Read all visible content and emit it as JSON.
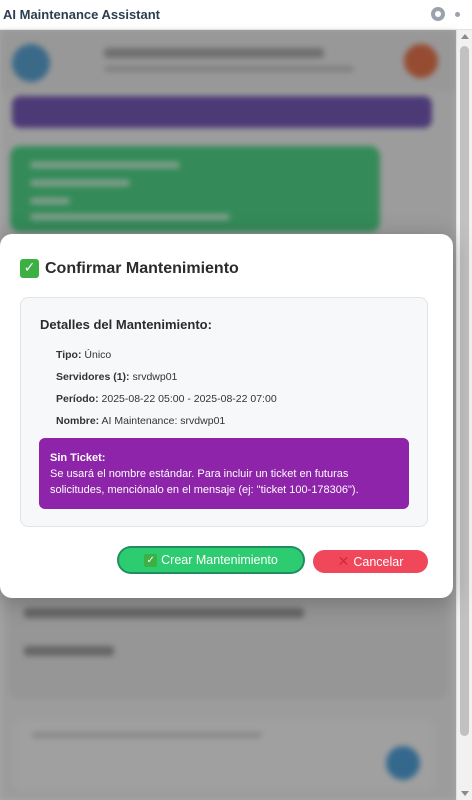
{
  "window": {
    "title": "AI Maintenance Assistant"
  },
  "modal": {
    "title": "Confirmar Mantenimiento",
    "details_title": "Detalles del Mantenimiento:",
    "rows": [
      {
        "label": "Tipo:",
        "value": "Único"
      },
      {
        "label": "Servidores (1):",
        "value": "srvdwp01"
      },
      {
        "label": "Período:",
        "value": "2025-08-22 05:00 - 2025-08-22 07:00"
      },
      {
        "label": "Nombre:",
        "value": "AI Maintenance: srvdwp01"
      }
    ],
    "notice_title": "Sin Ticket:",
    "notice_text": "Se usará el nombre estándar. Para incluir un ticket en futuras solicitudes, menciónalo en el mensaje (ej: \"ticket 100-178306\").",
    "create_label": "Crear Mantenimiento",
    "cancel_label": "Cancelar"
  },
  "icons": {
    "title_check": "check-mark-icon",
    "create_check": "check-mark-icon",
    "cancel_x": "x-mark-icon",
    "settings": "gear-icon"
  },
  "colors": {
    "create_button": "#2ecc71",
    "cancel_button": "#f0475a",
    "notice_bg": "#8e24aa"
  }
}
